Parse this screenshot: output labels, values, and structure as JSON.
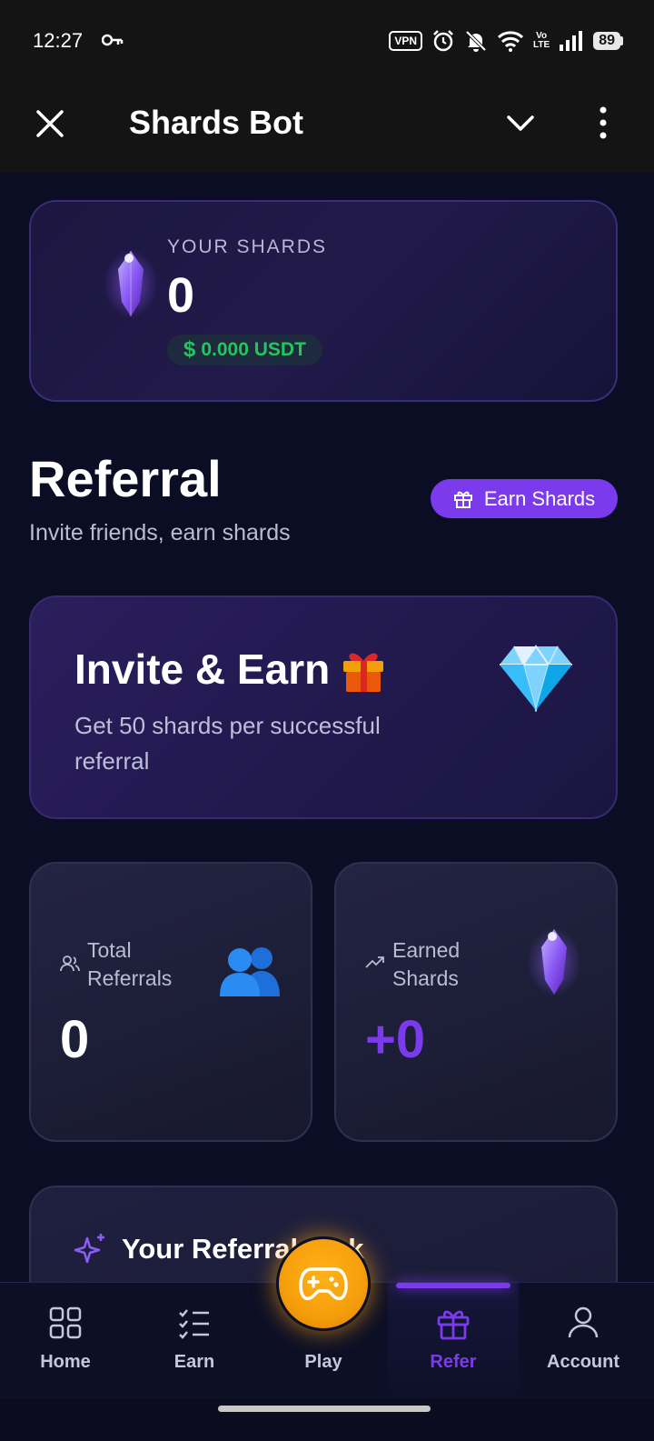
{
  "status_bar": {
    "time": "12:27",
    "vpn_label": "VPN",
    "volte_label": "Vo\nLTE",
    "battery": "89",
    "icons": [
      "key-icon",
      "alarm-icon",
      "mute-icon",
      "wifi-icon",
      "signal-icon"
    ]
  },
  "titlebar": {
    "title": "Shards Bot",
    "icons": [
      "close-icon",
      "chevron-down-icon",
      "more-vertical-icon"
    ]
  },
  "shards_card": {
    "label": "YOUR SHARDS",
    "value": "0",
    "usdt_symbol": "$",
    "usdt_value": "0.000 USDT"
  },
  "referral": {
    "heading": "Referral",
    "subtitle": "Invite friends, earn shards",
    "earn_button": "Earn Shards"
  },
  "invite_card": {
    "title": "Invite & Earn",
    "title_emoji": "gift",
    "description": "Get 50 shards per successful referral"
  },
  "stats": {
    "total_label": "Total Referrals",
    "total_value": "0",
    "earned_label": "Earned Shards",
    "earned_value": "+0"
  },
  "link_card": {
    "title": "Your Referral Link"
  },
  "bottom_nav": {
    "items": [
      {
        "label": "Home",
        "icon": "grid-icon"
      },
      {
        "label": "Earn",
        "icon": "checklist-icon"
      },
      {
        "label": "Play",
        "icon": "gamepad-icon"
      },
      {
        "label": "Refer",
        "icon": "gift-icon",
        "active": true
      },
      {
        "label": "Account",
        "icon": "user-icon"
      }
    ]
  },
  "colors": {
    "background": "#0b0d24",
    "accent": "#7c3aed",
    "usdt_green": "#22c55e",
    "play_orange": "#f59e0b"
  }
}
